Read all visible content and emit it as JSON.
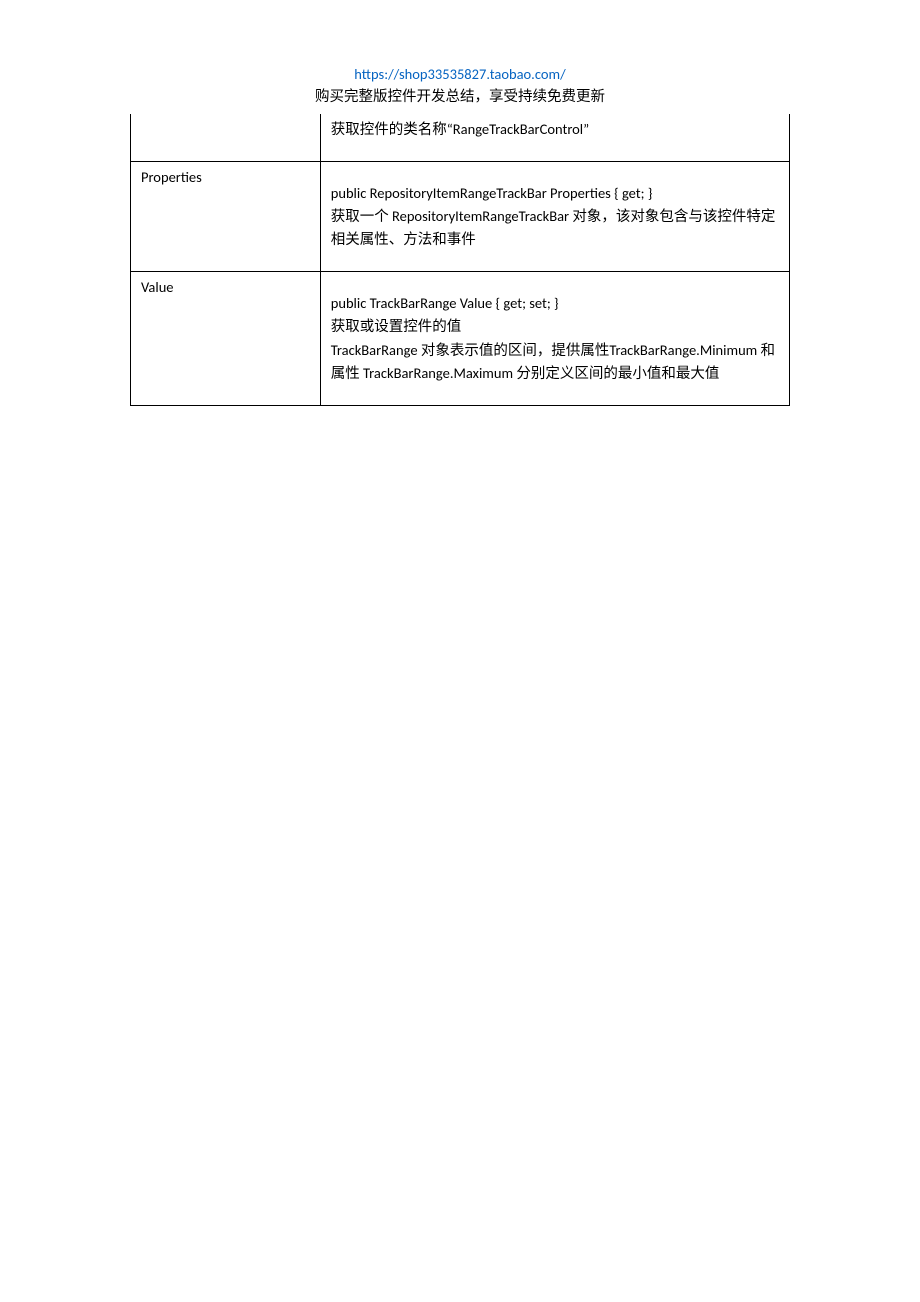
{
  "header": {
    "url": "https://shop33535827.taobao.com/",
    "tagline": "购买完整版控件开发总结，享受持续免费更新"
  },
  "rows": [
    {
      "label": "",
      "desc": "获取控件的类名称“RangeTrackBarControl”"
    },
    {
      "label": "Properties",
      "desc": "public RepositoryItemRangeTrackBar Properties { get; }\n获取一个 RepositoryItemRangeTrackBar 对象，该对象包含与该控件特定相关属性、方法和事件"
    },
    {
      "label": "Value",
      "desc": "public TrackBarRange Value { get; set; }\n获取或设置控件的值\nTrackBarRange 对象表示值的区间，提供属性TrackBarRange.Minimum 和 属性 TrackBarRange.Maximum 分别定义区间的最小值和最大值"
    }
  ]
}
